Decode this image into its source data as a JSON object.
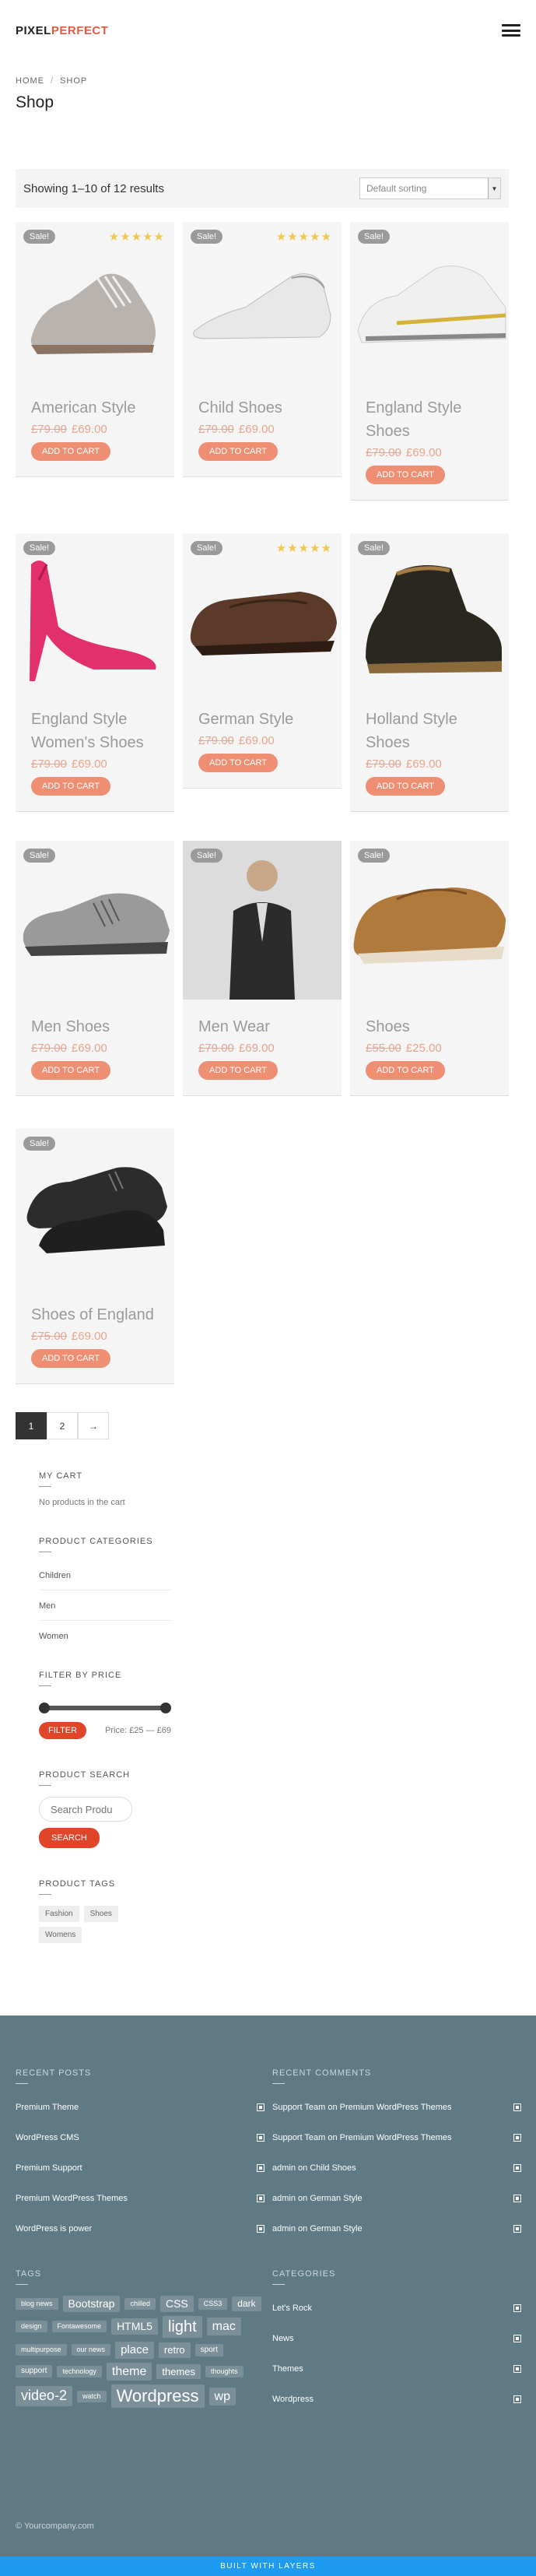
{
  "header": {
    "logo_part1": "PIXEL",
    "logo_part2": "PERFECT",
    "menu_icon": "hamburger-icon"
  },
  "breadcrumb": {
    "home": "HOME",
    "separator": "/",
    "current": "SHOP"
  },
  "page_title": "Shop",
  "shop": {
    "results_text": "Showing 1–10 of 12 results",
    "sort_value": "Default sorting",
    "sale_label": "Sale!",
    "stars": "★★★★★",
    "add_to_cart": "ADD TO CART",
    "products": [
      {
        "name": "American Style",
        "old_price": "£79.00",
        "price": "£69.00",
        "sale": true,
        "rating": 5,
        "image": "grey-sneaker"
      },
      {
        "name": "Child Shoes",
        "old_price": "£79.00",
        "price": "£69.00",
        "sale": true,
        "rating": 5,
        "image": "white-shoe"
      },
      {
        "name": "England Style Shoes",
        "old_price": "£79.00",
        "price": "£69.00",
        "sale": true,
        "rating": 0,
        "image": "white-sneaker"
      },
      {
        "name": "England Style Women's Shoes",
        "old_price": "£79.00",
        "price": "£69.00",
        "sale": true,
        "rating": 0,
        "image": "pink-heel"
      },
      {
        "name": "German Style",
        "old_price": "£79.00",
        "price": "£69.00",
        "sale": true,
        "rating": 5,
        "image": "brown-loafer"
      },
      {
        "name": "Holland Style Shoes",
        "old_price": "£79.00",
        "price": "£69.00",
        "sale": true,
        "rating": 0,
        "image": "black-boot"
      },
      {
        "name": "Men Shoes",
        "old_price": "£79.00",
        "price": "£69.00",
        "sale": true,
        "rating": 0,
        "image": "grey-oxford"
      },
      {
        "name": "Men Wear",
        "old_price": "£79.00",
        "price": "£69.00",
        "sale": true,
        "rating": 0,
        "image": "man-jacket"
      },
      {
        "name": "Shoes",
        "old_price": "£55.00",
        "price": "£25.00",
        "sale": true,
        "rating": 0,
        "image": "tan-shoe"
      },
      {
        "name": "Shoes of England",
        "old_price": "£75.00",
        "price": "£69.00",
        "sale": true,
        "rating": 0,
        "image": "black-oxford"
      }
    ],
    "pagination": [
      "1",
      "2",
      "→"
    ],
    "current_page": "1"
  },
  "sidebar": {
    "cart_title": "MY CART",
    "cart_empty": "No products in the cart",
    "categories_title": "PRODUCT CATEGORIES",
    "categories": [
      "Children",
      "Men",
      "Women"
    ],
    "filter_title": "FILTER BY PRICE",
    "filter_button": "FILTER",
    "price_range": "Price: £25 — £69",
    "search_title": "PRODUCT SEARCH",
    "search_placeholder": "Search Produ",
    "search_button": "SEARCH",
    "tags_title": "PRODUCT TAGS",
    "tags": [
      "Fashion",
      "Shoes",
      "Womens"
    ]
  },
  "footer": {
    "recent_posts_title": "RECENT POSTS",
    "recent_posts": [
      "Premium Theme",
      "WordPress CMS",
      "Premium Support",
      "Premium WordPress Themes",
      "WordPress is power"
    ],
    "recent_comments_title": "RECENT COMMENTS",
    "recent_comments": [
      {
        "author": "Support Team",
        "on": "on",
        "post": "Premium WordPress Themes"
      },
      {
        "author": "Support Team",
        "on": "on",
        "post": "Premium WordPress Themes"
      },
      {
        "author": "admin",
        "on": "on",
        "post": "Child Shoes"
      },
      {
        "author": "admin",
        "on": "on",
        "post": "German Style"
      },
      {
        "author": "admin",
        "on": "on",
        "post": "German Style"
      }
    ],
    "tags_title": "TAGS",
    "tag_cloud": [
      {
        "label": "blog news",
        "size": 9
      },
      {
        "label": "Bootstrap",
        "size": 14
      },
      {
        "label": "chilled",
        "size": 9
      },
      {
        "label": "CSS",
        "size": 14
      },
      {
        "label": "CSS3",
        "size": 9
      },
      {
        "label": "dark",
        "size": 12
      },
      {
        "label": "design",
        "size": 9
      },
      {
        "label": "Fontawesome",
        "size": 9
      },
      {
        "label": "HTML5",
        "size": 14
      },
      {
        "label": "light",
        "size": 20
      },
      {
        "label": "mac",
        "size": 16
      },
      {
        "label": "multipurpose",
        "size": 9
      },
      {
        "label": "our news",
        "size": 9
      },
      {
        "label": "place",
        "size": 15
      },
      {
        "label": "retro",
        "size": 13
      },
      {
        "label": "sport",
        "size": 10
      },
      {
        "label": "support",
        "size": 10
      },
      {
        "label": "technology",
        "size": 9
      },
      {
        "label": "theme",
        "size": 16
      },
      {
        "label": "themes",
        "size": 13
      },
      {
        "label": "thoughts",
        "size": 9
      },
      {
        "label": "video-2",
        "size": 18
      },
      {
        "label": "watch",
        "size": 9
      },
      {
        "label": "Wordpress",
        "size": 22
      },
      {
        "label": "wp",
        "size": 16
      }
    ],
    "categories_title": "CATEGORIES",
    "categories": [
      "Let's Rock",
      "News",
      "Themes",
      "Wordpress"
    ],
    "copyright": "© Yourcompany.com",
    "built_with": "BUILT WITH LAYERS"
  }
}
